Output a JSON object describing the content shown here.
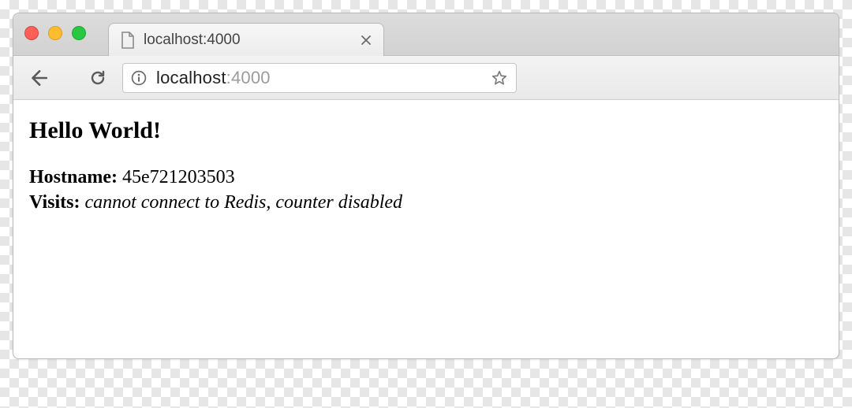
{
  "tab": {
    "title": "localhost:4000"
  },
  "omnibox": {
    "host": "localhost",
    "port": ":4000"
  },
  "page": {
    "heading": "Hello World!",
    "hostname_label": "Hostname: ",
    "hostname_value": "45e721203503",
    "visits_label": "Visits: ",
    "visits_value": "cannot connect to Redis, counter disabled"
  }
}
